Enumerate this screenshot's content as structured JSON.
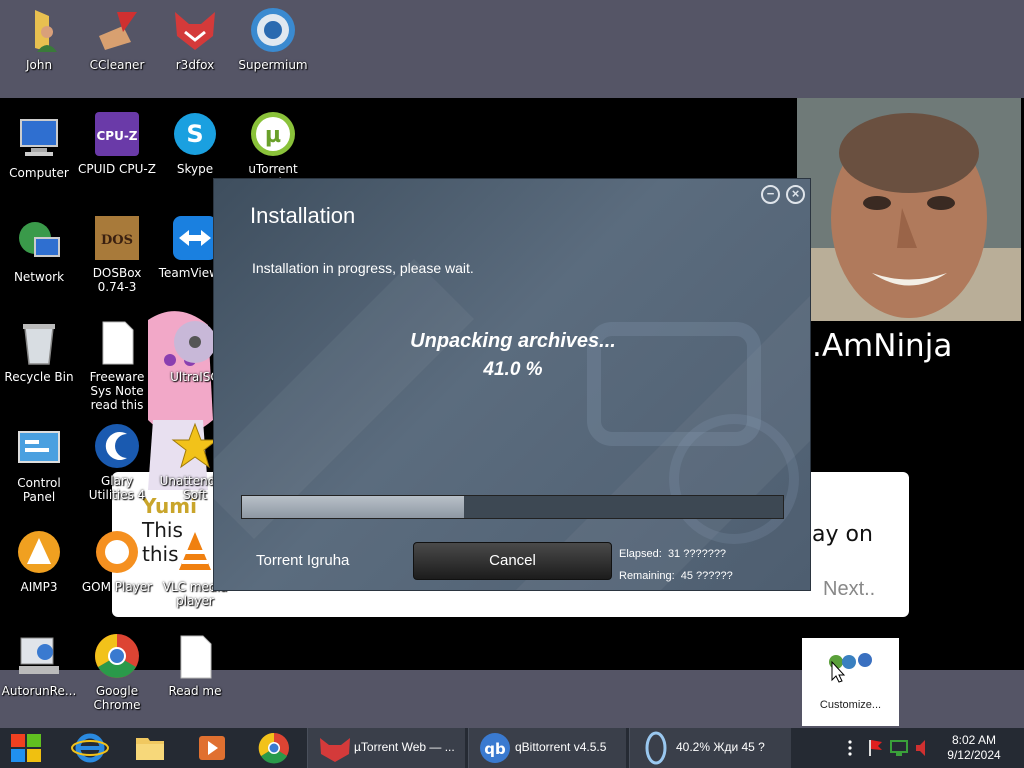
{
  "desktop_icons": [
    {
      "label": "John",
      "icon": "user-folder-icon"
    },
    {
      "label": "CCleaner",
      "icon": "ccleaner-icon"
    },
    {
      "label": "r3dfox",
      "icon": "r3dfox-icon"
    },
    {
      "label": "Supermium",
      "icon": "supermium-icon"
    },
    {
      "label": "Computer",
      "icon": "computer-icon"
    },
    {
      "label": "CPUID CPU-Z",
      "icon": "cpuz-icon"
    },
    {
      "label": "Skype",
      "icon": "skype-icon"
    },
    {
      "label": "uTorrent Web",
      "icon": "utorrent-icon"
    },
    {
      "label": "Network",
      "icon": "network-icon"
    },
    {
      "label": "DOSBox 0.74-3",
      "icon": "dosbox-icon"
    },
    {
      "label": "TeamViewer",
      "icon": "teamviewer-icon"
    },
    {
      "label": "Recycle Bin",
      "icon": "recycle-bin-icon"
    },
    {
      "label": "Freeware Sys Note read this",
      "icon": "document-icon"
    },
    {
      "label": "UltraISO",
      "icon": "ultraiso-icon"
    },
    {
      "label": "Control Panel",
      "icon": "control-panel-icon"
    },
    {
      "label": "Glary Utilities 4",
      "icon": "glary-icon"
    },
    {
      "label": "Unattended Soft",
      "icon": "star-icon"
    },
    {
      "label": "AIMP3",
      "icon": "aimp-icon"
    },
    {
      "label": "GOM Player",
      "icon": "gom-icon"
    },
    {
      "label": "VLC media player",
      "icon": "vlc-icon"
    },
    {
      "label": "AutorunRe...",
      "icon": "autorun-icon"
    },
    {
      "label": "Google Chrome",
      "icon": "chrome-icon"
    },
    {
      "label": "Read me",
      "icon": "document-icon"
    }
  ],
  "background_window": {
    "title_fragment": ".AmNinja",
    "left_text_1": "Yumi",
    "left_text_2": "This",
    "left_text_3": "this",
    "right_text": "ay on",
    "next_label": "Next.."
  },
  "installer": {
    "title": "Installation",
    "subtitle": "Installation in progress, please wait.",
    "status": "Unpacking archives...",
    "percent_label": "41.0 %",
    "progress": 0.41,
    "brand": "Torrent Igruha",
    "cancel_label": "Cancel",
    "elapsed_label": "Elapsed:",
    "elapsed_value": "31 ???????",
    "remaining_label": "Remaining:",
    "remaining_value": "45 ??????",
    "minimize_glyph": "−",
    "close_glyph": "×"
  },
  "customize_popup": {
    "label": "Customize..."
  },
  "taskbar": {
    "tasks": [
      {
        "label": "µTorrent Web — ...",
        "icon": "r3dfox-icon"
      },
      {
        "label": "qBittorrent v4.5.5",
        "icon": "qbittorrent-icon"
      },
      {
        "label": "40.2%  Жди 45 ?",
        "icon": "installer-icon"
      }
    ],
    "clock_time": "8:02 AM",
    "clock_date": "9/12/2024",
    "colors": {
      "bg": "#252a33",
      "task": "#3a3f4a"
    }
  }
}
